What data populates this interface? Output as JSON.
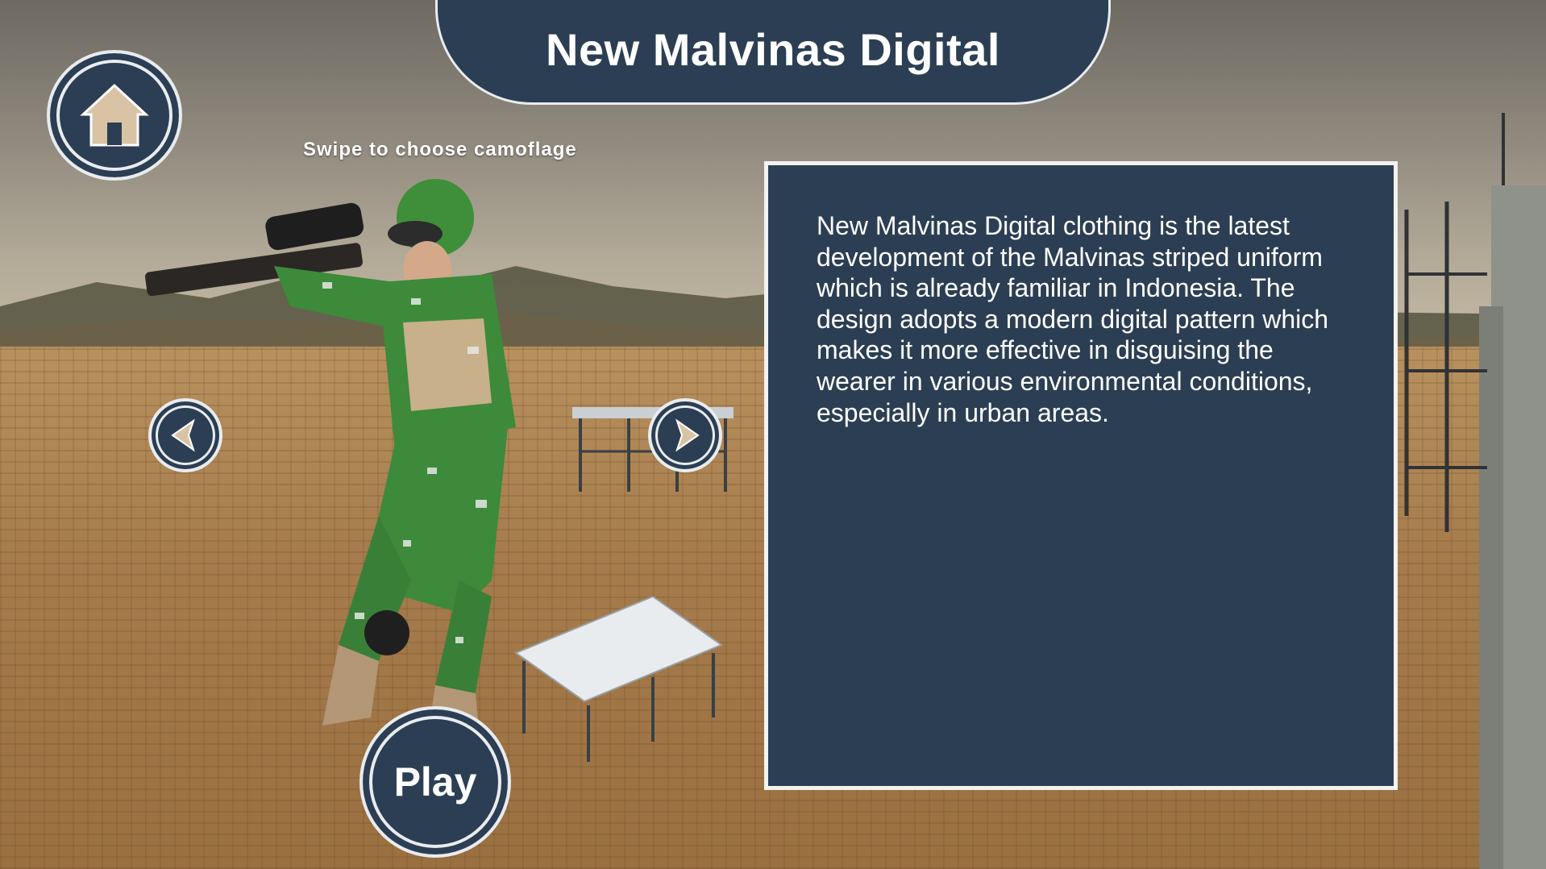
{
  "header": {
    "title": "New Malvinas Digital"
  },
  "hint": {
    "text": "Swipe to choose camoflage"
  },
  "description": {
    "text": "New Malvinas Digital clothing is the latest development of the Malvinas striped uniform which is already familiar in Indonesia. The design adopts a modern digital pattern which makes it more effective in disguising the wearer in various environmental conditions, especially in urban areas."
  },
  "buttons": {
    "play_label": "Play"
  },
  "icons": {
    "home": "home-icon",
    "prev": "chevron-left-icon",
    "next": "chevron-right-icon"
  },
  "colors": {
    "panel": "#2c3e53",
    "border": "#e8ecef",
    "home_icon": "#d8c3a5",
    "text": "#ffffff"
  }
}
